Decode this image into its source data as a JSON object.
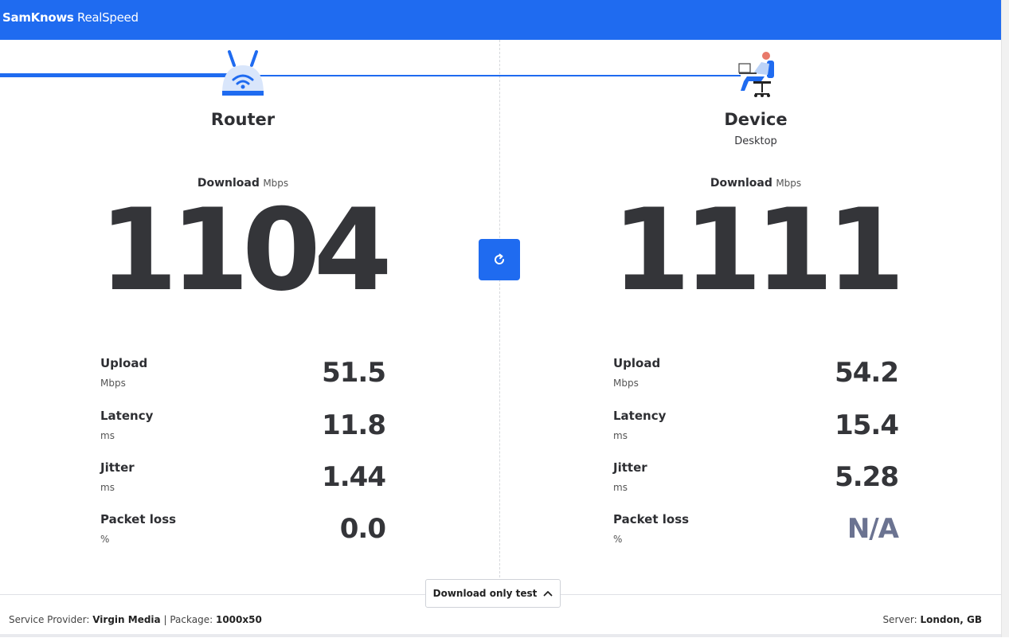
{
  "header": {
    "brand_bold": "SamKnows",
    "brand_regular": "RealSpeed"
  },
  "router": {
    "title": "Router",
    "download_label": "Download",
    "download_unit": "Mbps",
    "download_value": "1104",
    "metrics": [
      {
        "name": "Upload",
        "unit": "Mbps",
        "value": "51.5"
      },
      {
        "name": "Latency",
        "unit": "ms",
        "value": "11.8"
      },
      {
        "name": "Jitter",
        "unit": "ms",
        "value": "1.44"
      },
      {
        "name": "Packet loss",
        "unit": "%",
        "value": "0.0"
      }
    ]
  },
  "device": {
    "title": "Device",
    "subtitle": "Desktop",
    "download_label": "Download",
    "download_unit": "Mbps",
    "download_value": "1111",
    "metrics": [
      {
        "name": "Upload",
        "unit": "Mbps",
        "value": "54.2"
      },
      {
        "name": "Latency",
        "unit": "ms",
        "value": "15.4"
      },
      {
        "name": "Jitter",
        "unit": "ms",
        "value": "5.28"
      },
      {
        "name": "Packet loss",
        "unit": "%",
        "value": "N/A"
      }
    ]
  },
  "controls": {
    "refresh_icon": "refresh-icon",
    "mode_label": "Download only test",
    "mode_icon": "chevron-up-icon"
  },
  "footer": {
    "provider_label": "Service Provider:",
    "provider_value": "Virgin Media",
    "separator": "|",
    "package_label": "Package:",
    "package_value": "1000x50",
    "server_label": "Server:",
    "server_value": "London, GB"
  },
  "colors": {
    "accent": "#1f6bf0",
    "text": "#343539",
    "na_text": "#6b7391"
  }
}
